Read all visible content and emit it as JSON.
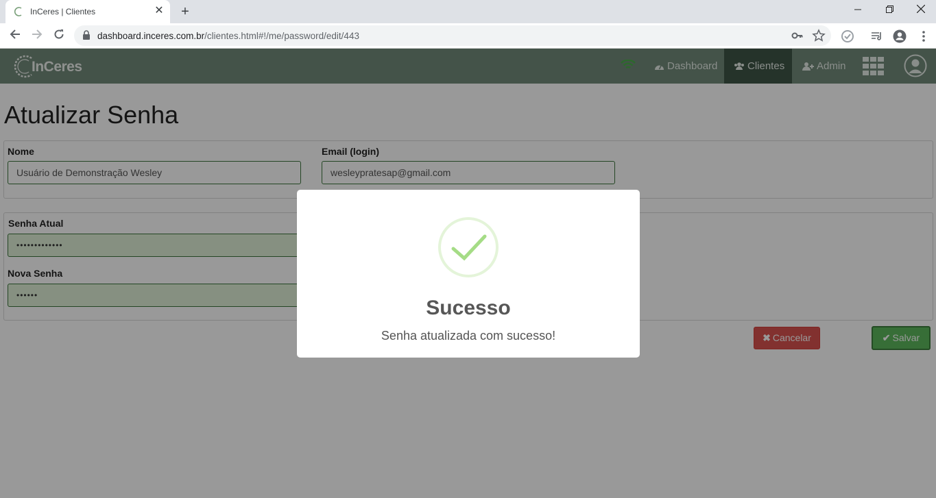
{
  "browser": {
    "tab_title": "InCeres | Clientes",
    "url_host": "dashboard.inceres.com.br",
    "url_path": "/clientes.html#!/me/password/edit/443"
  },
  "app": {
    "logo_text": "InCeres",
    "nav": {
      "dashboard": "Dashboard",
      "clientes": "Clientes",
      "admin": "Admin"
    },
    "accent_color": "#728a7a",
    "active_color": "#3f5546"
  },
  "page": {
    "title": "Atualizar Senha",
    "nome_label": "Nome",
    "nome_value": "Usuário de Demonstração Wesley",
    "email_label": "Email (login)",
    "email_value": "wesleypratesap@gmail.com",
    "senha_atual_label": "Senha Atual",
    "senha_atual_value": "•••••••••••••",
    "nova_senha_label": "Nova Senha",
    "nova_senha_value": "••••••",
    "cancel_label": "Cancelar",
    "save_label": "Salvar"
  },
  "modal": {
    "title": "Sucesso",
    "message": "Senha atualizada com sucesso!"
  }
}
